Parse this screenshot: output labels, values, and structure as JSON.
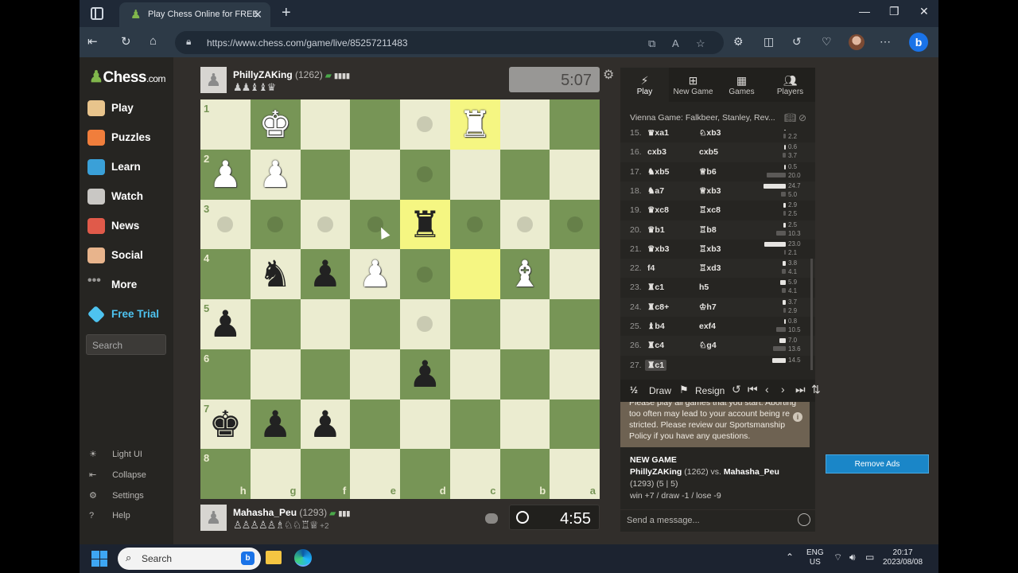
{
  "browser": {
    "tab_title": "Play Chess Online for FREE",
    "url": "https://www.chess.com/game/live/85257211483"
  },
  "sidebar": {
    "logo": "Chess",
    "logo_suffix": ".com",
    "items": [
      {
        "label": "Play",
        "icon": "play-pawn-icon",
        "color": "#e8c48c"
      },
      {
        "label": "Puzzles",
        "icon": "puzzle-icon",
        "color": "#f07e3c"
      },
      {
        "label": "Learn",
        "icon": "learn-cube-icon",
        "color": "#3aa0d8"
      },
      {
        "label": "Watch",
        "icon": "binoculars-icon",
        "color": "#c9c7c4"
      },
      {
        "label": "News",
        "icon": "news-icon",
        "color": "#e05a4a"
      },
      {
        "label": "Social",
        "icon": "social-icon",
        "color": "#e8b48c"
      },
      {
        "label": "More",
        "icon": "more-dots-icon",
        "color": "#989795"
      },
      {
        "label": "Free Trial",
        "icon": "diamond-icon",
        "color": "#4ec3f0"
      }
    ],
    "search_placeholder": "Search",
    "bottom": [
      {
        "label": "Light UI",
        "icon": "sun-icon"
      },
      {
        "label": "Collapse",
        "icon": "collapse-icon"
      },
      {
        "label": "Settings",
        "icon": "gear-icon"
      },
      {
        "label": "Help",
        "icon": "help-icon"
      }
    ]
  },
  "top_player": {
    "name": "PhillyZAKing",
    "rating": "(1262)",
    "captured": "♟♟♝♝♛",
    "clock": "5:07"
  },
  "bottom_player": {
    "name": "Mahasha_Peu",
    "rating": "(1293)",
    "captured": "♙♙♙♙♙♗♘♘♖♕",
    "advantage": "+2",
    "clock": "4:55"
  },
  "board": {
    "ranks": [
      "1",
      "2",
      "3",
      "4",
      "5",
      "6",
      "7",
      "8"
    ],
    "files": [
      "h",
      "g",
      "f",
      "e",
      "d",
      "c",
      "b",
      "a"
    ],
    "light_color": "#ebecd0",
    "dark_color": "#779556",
    "highlight_color": "#f5f682",
    "pieces": [
      {
        "row": 0,
        "col": 1,
        "glyph": "♚",
        "side": "w"
      },
      {
        "row": 0,
        "col": 5,
        "glyph": "♜",
        "side": "w"
      },
      {
        "row": 1,
        "col": 0,
        "glyph": "♟",
        "side": "w"
      },
      {
        "row": 1,
        "col": 1,
        "glyph": "♟",
        "side": "w"
      },
      {
        "row": 2,
        "col": 4,
        "glyph": "♜",
        "side": "b"
      },
      {
        "row": 3,
        "col": 1,
        "glyph": "♞",
        "side": "b"
      },
      {
        "row": 3,
        "col": 2,
        "glyph": "♟",
        "side": "b"
      },
      {
        "row": 3,
        "col": 3,
        "glyph": "♟",
        "side": "w"
      },
      {
        "row": 3,
        "col": 6,
        "glyph": "♝",
        "side": "w"
      },
      {
        "row": 4,
        "col": 0,
        "glyph": "♟",
        "side": "b"
      },
      {
        "row": 5,
        "col": 4,
        "glyph": "♟",
        "side": "b"
      },
      {
        "row": 6,
        "col": 0,
        "glyph": "♚",
        "side": "b"
      },
      {
        "row": 6,
        "col": 1,
        "glyph": "♟",
        "side": "b"
      },
      {
        "row": 6,
        "col": 2,
        "glyph": "♟",
        "side": "b"
      }
    ],
    "highlights": [
      [
        0,
        5
      ],
      [
        2,
        4
      ],
      [
        3,
        5
      ]
    ],
    "hints": [
      [
        0,
        4
      ],
      [
        1,
        4
      ],
      [
        2,
        0
      ],
      [
        2,
        1
      ],
      [
        2,
        2
      ],
      [
        2,
        3
      ],
      [
        2,
        5
      ],
      [
        2,
        6
      ],
      [
        2,
        7
      ],
      [
        3,
        4
      ],
      [
        4,
        4
      ]
    ]
  },
  "panel": {
    "tabs": [
      {
        "label": "Play",
        "icon": "lightning-icon"
      },
      {
        "label": "New Game",
        "icon": "plus-square-icon"
      },
      {
        "label": "Games",
        "icon": "board-icon"
      },
      {
        "label": "Players",
        "icon": "players-icon"
      }
    ],
    "opening": "Vienna Game: Falkbeer, Stanley, Rev...",
    "moves": [
      {
        "num": "15.",
        "white": "♛xa1",
        "black": "♘xb3",
        "tw": "1.9",
        "tb": "2.2",
        "w": 0.08,
        "b": 0.1
      },
      {
        "num": "16.",
        "white": "cxb3",
        "black": "cxb5",
        "tw": "0.6",
        "tb": "3.7",
        "w": 0.03,
        "b": 0.15
      },
      {
        "num": "17.",
        "white": "♞xb5",
        "black": "♕b6",
        "tw": "0.5",
        "tb": "20.0",
        "w": 0.02,
        "b": 0.85
      },
      {
        "num": "18.",
        "white": "♞a7",
        "black": "♕xb3",
        "tw": "24.7",
        "tb": "5.0",
        "w": 1.0,
        "b": 0.2
      },
      {
        "num": "19.",
        "white": "♛xc8",
        "black": "♖xc8",
        "tw": "2.9",
        "tb": "2.5",
        "w": 0.12,
        "b": 0.1
      },
      {
        "num": "20.",
        "white": "♛b1",
        "black": "♖b8",
        "tw": "2.5",
        "tb": "10.3",
        "w": 0.1,
        "b": 0.42
      },
      {
        "num": "21.",
        "white": "♛xb3",
        "black": "♖xb3",
        "tw": "23.0",
        "tb": "2.1",
        "w": 0.95,
        "b": 0.08
      },
      {
        "num": "22.",
        "white": "f4",
        "black": "♖xd3",
        "tw": "3.8",
        "tb": "4.1",
        "w": 0.16,
        "b": 0.17
      },
      {
        "num": "23.",
        "white": "♜c1",
        "black": "h5",
        "tw": "5.9",
        "tb": "4.1",
        "w": 0.24,
        "b": 0.17
      },
      {
        "num": "24.",
        "white": "♜c8+",
        "black": "♔h7",
        "tw": "3.7",
        "tb": "2.9",
        "w": 0.15,
        "b": 0.12
      },
      {
        "num": "25.",
        "white": "♝b4",
        "black": "exf4",
        "tw": "0.8",
        "tb": "10.5",
        "w": 0.03,
        "b": 0.43
      },
      {
        "num": "26.",
        "white": "♜c4",
        "black": "♘g4",
        "tw": "7.0",
        "tb": "13.6",
        "w": 0.29,
        "b": 0.56
      },
      {
        "num": "27.",
        "white": "♜c1",
        "black": "",
        "tw": "14.5",
        "tb": "",
        "w": 0.6,
        "b": 0
      }
    ],
    "draw_label": "Draw",
    "resign_label": "Resign",
    "half_symbol": "½",
    "warning": "Please play all games that you start. Aborting too often may lead to your account being re stricted. Please review our Sportsmanship Policy if you have any questions.",
    "newgame_header": "NEW GAME",
    "newgame_white": "PhillyZAKing",
    "newgame_white_rating": "(1262) vs.",
    "newgame_black": "Mahasha_Peu",
    "newgame_black_rating": "(1293) (5 | 5)",
    "newgame_result": "win +7 / draw -1 / lose -9",
    "message_placeholder": "Send a message..."
  },
  "remove_ads": "Remove Ads",
  "taskbar": {
    "search_placeholder": "Search",
    "lang": "ENG",
    "region": "US",
    "time": "20:17",
    "date": "2023/08/08"
  }
}
